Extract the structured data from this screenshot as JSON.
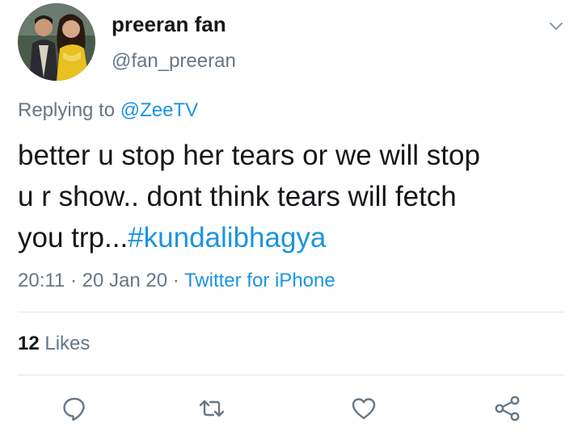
{
  "tweet": {
    "display_name": "preeran fan",
    "handle": "@fan_preeran",
    "replying_prefix": "Replying to",
    "replying_mention": "@ZeeTV",
    "text_line1": "better u stop her tears or we will stop",
    "text_line2": "u r show.. dont think tears will fetch",
    "text_line3_plain": "you trp...",
    "hashtag": "#kundalibhagya",
    "time": "20:11",
    "date": "20 Jan 20",
    "separator": "·",
    "source": "Twitter for iPhone",
    "likes_count": "12",
    "likes_label": "Likes"
  },
  "icons": {
    "caret": "chevron-down-icon",
    "reply": "reply-icon",
    "retweet": "retweet-icon",
    "like": "heart-icon",
    "share": "share-icon"
  },
  "colors": {
    "link": "#1b95e0",
    "secondary_text": "#657786",
    "primary_text": "#14171a",
    "divider": "#e1e8ed"
  }
}
